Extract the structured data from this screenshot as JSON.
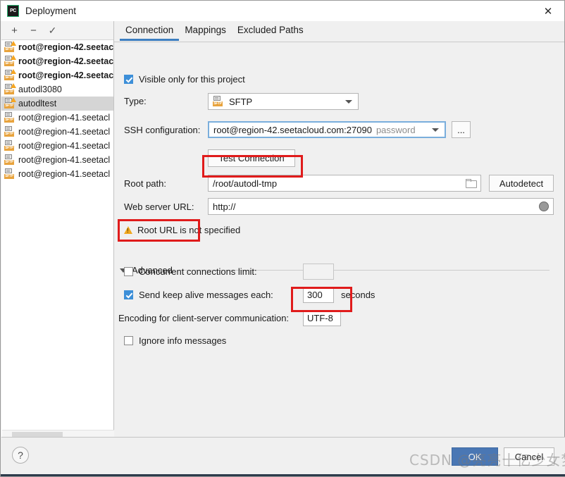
{
  "window": {
    "title": "Deployment",
    "app_logo_text": "PC",
    "close_icon": "close-icon"
  },
  "left_toolbar": {
    "add_label": "+",
    "remove_label": "−",
    "apply_label": "✓"
  },
  "deployment_list": {
    "items": [
      {
        "label": "root@region-42.seetac",
        "bold": true,
        "warning": true,
        "selected": false
      },
      {
        "label": "root@region-42.seetac",
        "bold": true,
        "warning": true,
        "selected": false
      },
      {
        "label": "root@region-42.seetac",
        "bold": true,
        "warning": true,
        "selected": false
      },
      {
        "label": "autodl3080",
        "bold": false,
        "warning": true,
        "selected": false
      },
      {
        "label": "autodltest",
        "bold": false,
        "warning": true,
        "selected": true
      },
      {
        "label": "root@region-41.seetacl",
        "bold": false,
        "warning": false,
        "selected": false
      },
      {
        "label": "root@region-41.seetacl",
        "bold": false,
        "warning": false,
        "selected": false
      },
      {
        "label": "root@region-41.seetacl",
        "bold": false,
        "warning": false,
        "selected": false
      },
      {
        "label": "root@region-41.seetacl",
        "bold": false,
        "warning": false,
        "selected": false
      },
      {
        "label": "root@region-41.seetacl",
        "bold": false,
        "warning": false,
        "selected": false
      }
    ],
    "icon_tag": "SFTP"
  },
  "tabs": [
    {
      "label": "Connection",
      "active": true
    },
    {
      "label": "Mappings",
      "active": false
    },
    {
      "label": "Excluded Paths",
      "active": false
    }
  ],
  "form": {
    "visible_only_label": "Visible only for this project",
    "visible_only_checked": true,
    "type_label": "Type:",
    "type_value": "SFTP",
    "type_icon_tag": "SFTP",
    "ssh_label": "SSH configuration:",
    "ssh_value": "root@region-42.seetacloud.com:27090",
    "ssh_auth_hint": "password",
    "ssh_browse_label": "...",
    "test_connection_label": "Test Connection",
    "root_path_label": "Root path:",
    "root_path_value": "/root/autodl-tmp",
    "root_path_browse_icon": "folder-icon",
    "autodetect_label": "Autodetect",
    "web_url_label": "Web server URL:",
    "web_url_value": "http://",
    "web_url_icon": "globe-icon",
    "warning_text": "Root URL is not specified",
    "advanced_label": "Advanced",
    "advanced_expanded": true,
    "concurrent_label": "Concurrent connections limit:",
    "concurrent_checked": false,
    "concurrent_value": "",
    "keepalive_label": "Send keep alive messages each:",
    "keepalive_checked": true,
    "keepalive_value": "300",
    "keepalive_unit": "seconds",
    "encoding_label": "Encoding for client-server communication:",
    "encoding_value": "UTF-8",
    "ignore_info_label": "Ignore info messages",
    "ignore_info_checked": false
  },
  "bottom": {
    "help_label": "?",
    "ok_label": "OK",
    "cancel_label": "Cancel"
  },
  "watermark": {
    "prefix": "CSDN ",
    "handle": "@亮亮十亿少女梦"
  },
  "colors": {
    "accent_blue": "#3d7fc1",
    "checkbox_blue": "#3d8fd8",
    "annotation_red": "#e01b1b",
    "warning_orange": "#f0a81e",
    "sftp_tag_orange": "#e8a33d"
  }
}
